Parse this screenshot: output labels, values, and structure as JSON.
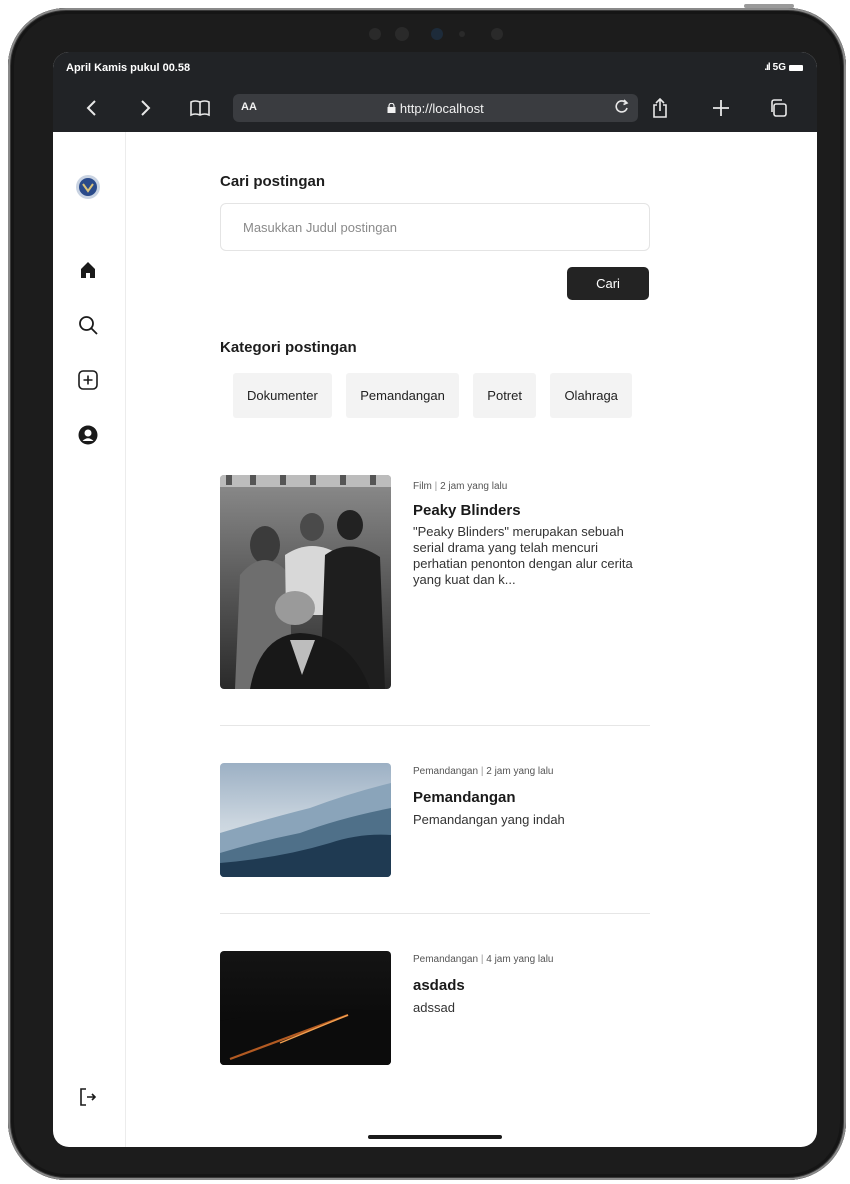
{
  "status": {
    "time": "April Kamis pukul 00.58",
    "network": "5G"
  },
  "browser": {
    "text_size": "AA",
    "url": "http://localhost"
  },
  "search": {
    "title": "Cari postingan",
    "placeholder": "Masukkan Judul postingan",
    "button": "Cari"
  },
  "categories": {
    "title": "Kategori postingan",
    "items": [
      "Dokumenter",
      "Pemandangan",
      "Potret",
      "Olahraga"
    ]
  },
  "posts": [
    {
      "category": "Film",
      "time": "2 jam yang lalu",
      "title": "Peaky Blinders",
      "description": "\"Peaky Blinders\" merupakan sebuah serial drama yang telah mencuri perhatian penonton dengan alur cerita yang kuat dan k..."
    },
    {
      "category": "Pemandangan",
      "time": "2 jam yang lalu",
      "title": "Pemandangan",
      "description": "Pemandangan yang indah"
    },
    {
      "category": "Pemandangan",
      "time": "4 jam yang lalu",
      "title": "asdads",
      "description": "adssad"
    }
  ],
  "colors": {
    "toolbar": "#212326",
    "button": "#232323",
    "chip": "#f3f3f3",
    "logo": "#2a4a8a"
  },
  "icons": [
    "back-icon",
    "forward-icon",
    "bookmarks-icon",
    "lock-icon",
    "reload-icon",
    "share-icon",
    "new-tab-icon",
    "tabs-icon",
    "home-icon",
    "search-icon",
    "add-icon",
    "profile-icon",
    "logout-icon"
  ]
}
